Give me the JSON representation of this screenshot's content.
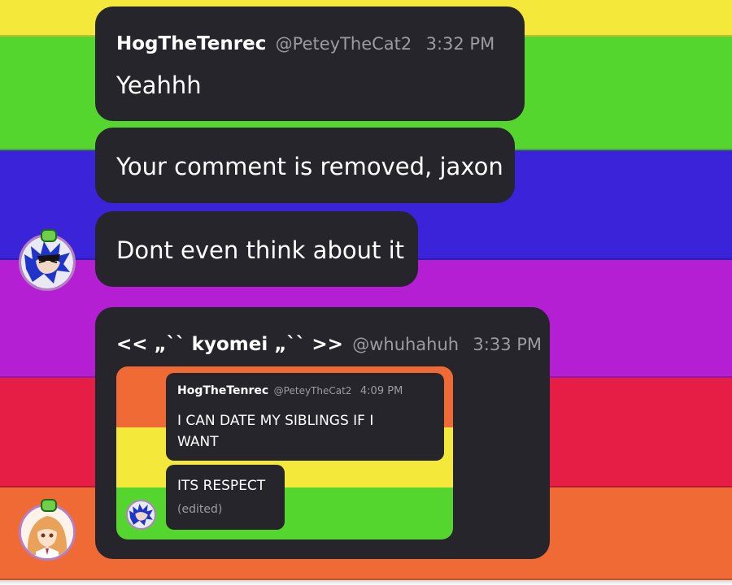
{
  "background": {
    "stripes": [
      "#f4e93a",
      "#55d62f",
      "#3a23d8",
      "#b51fd3",
      "#e61e45",
      "#f06a35"
    ]
  },
  "messages": [
    {
      "user": "HogTheTenrec",
      "handle": "@PeteyTheCat2",
      "time": "3:32 PM",
      "text": "Yeahhh"
    },
    {
      "text": "Your comment is removed, jaxon"
    },
    {
      "text": "Dont even think about it"
    }
  ],
  "reply": {
    "user": "<< „ˋˋ kyomei „ˋˋ >>",
    "handle": "@whuhahuh",
    "time": "3:33 PM",
    "quoted": {
      "user": "HogTheTenrec",
      "handle": "@PeteyTheCat2",
      "time": "4:09 PM",
      "text": "I CAN DATE MY SIBLINGS IF I WANT",
      "second_text": "ITS RESPECT",
      "edited": "(edited)"
    }
  },
  "avatars": {
    "hog": "hedgehog-avatar",
    "kyomei": "anime-girl-avatar"
  },
  "colors": {
    "bubble": "#26252c",
    "meta": "#9c9ba3",
    "avatar_ring": "#b47fc4"
  }
}
